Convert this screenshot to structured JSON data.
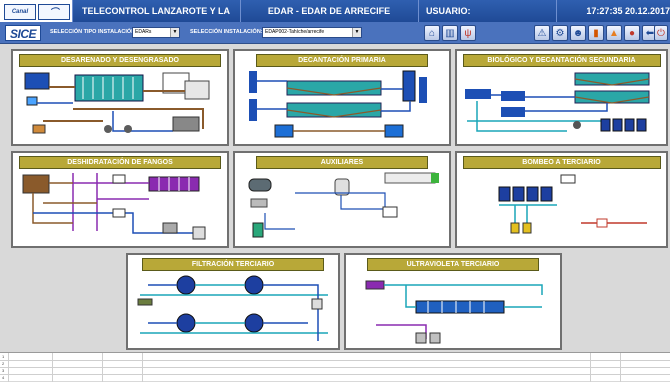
{
  "header": {
    "logo_left": "Canal",
    "app_title": "TELECONTROL LANZAROTE Y LA GRACIOSA",
    "plant_title": "EDAR - EDAR DE ARRECIFE",
    "user_label": "USUARIO:",
    "time": "17:27:35",
    "date": "20.12.2017",
    "clock_text": "17:27:35  20.12.2017"
  },
  "toolbar": {
    "brand": "SICE",
    "type_label": "SELECCIÓN TIPO INSTALACIÓN:",
    "type_value": "EDARs",
    "install_label": "SELECCIÓN INSTALACIÓN:",
    "install_value": "EDAP002-Tahíche/arrecife"
  },
  "panels": {
    "desarenado": "DESARENADO Y DESENGRASADO",
    "decantacion": "DECANTACIÓN PRIMARIA",
    "biologico": "BIOLÓGICO Y DECANTACIÓN SECUNDARIA",
    "deshidratacion": "DESHIDRATACIÓN DE FANGOS",
    "auxiliares": "AUXILIARES",
    "bombeo": "BOMBEO A TERCIARIO",
    "filtracion": "FILTRACIÓN TERCIARIO",
    "ultravioleta": "ULTRAVIOLETA TERCIARIO"
  },
  "grid": {
    "rows": [
      "1",
      "2",
      "3",
      "4"
    ]
  },
  "colors": {
    "titlebar": "#1f4a96",
    "toolbar": "#4a72bd",
    "panel_header": "#b8a838",
    "pipe_blue": "#1d4fb5",
    "pipe_brown": "#8a5a2b",
    "pipe_purple": "#8a2bb0",
    "pipe_cyan": "#1aa6b8"
  }
}
